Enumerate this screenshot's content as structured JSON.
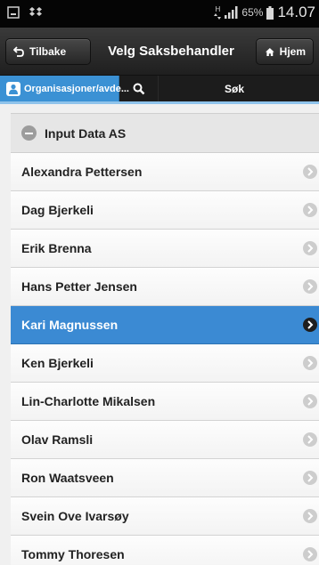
{
  "status_bar": {
    "network_label": "H",
    "battery_percent": "65%",
    "time": "14.07"
  },
  "top_bar": {
    "back_label": "Tilbake",
    "title": "Velg Saksbehandler",
    "home_label": "Hjem"
  },
  "nav_bar": {
    "org_label": "Organisasjoner/avde...",
    "search_label": "Søk"
  },
  "list": {
    "group_label": "Input Data AS",
    "items": [
      {
        "label": "Alexandra Pettersen"
      },
      {
        "label": "Dag Bjerkeli"
      },
      {
        "label": "Erik Brenna"
      },
      {
        "label": "Hans Petter Jensen"
      },
      {
        "label": "Kari Magnussen",
        "selected": true
      },
      {
        "label": "Ken Bjerkeli"
      },
      {
        "label": "Lin-Charlotte Mikalsen"
      },
      {
        "label": "Olav Ramsli"
      },
      {
        "label": "Ron Waatsveen"
      },
      {
        "label": "Svein Ove Ivarsøy"
      },
      {
        "label": "Tommy Thoresen"
      }
    ]
  },
  "colors": {
    "accent": "#3b91d4",
    "selected_row": "#3b8ad3",
    "header_dark": "#1f1f1f"
  }
}
